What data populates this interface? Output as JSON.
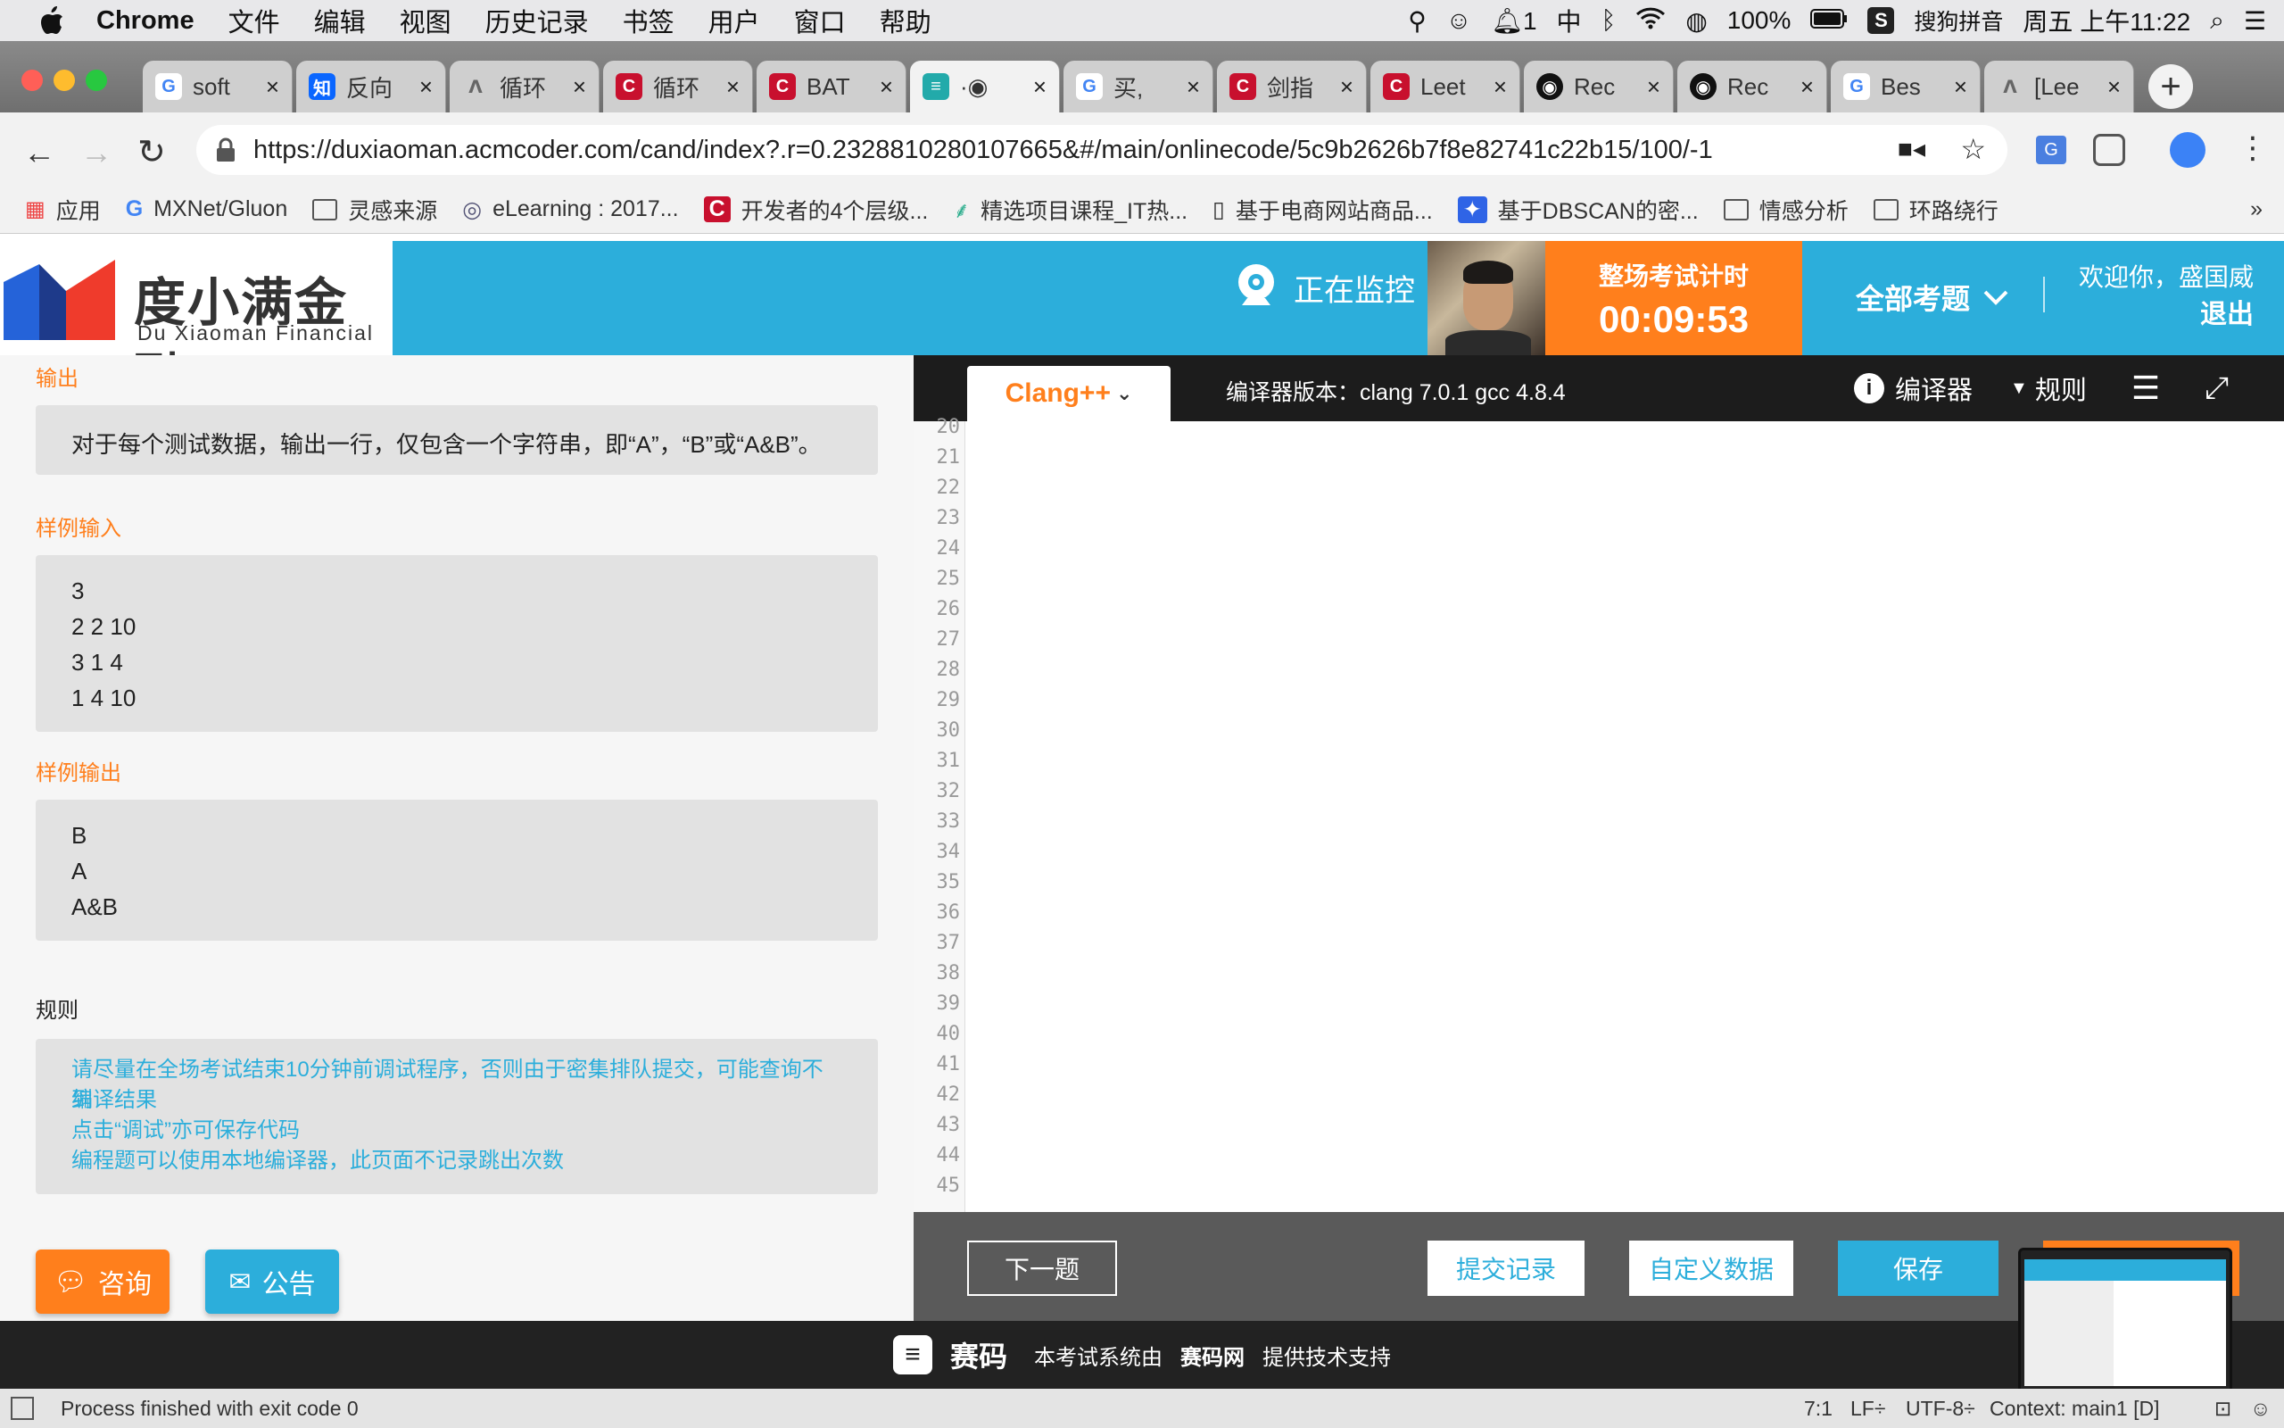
{
  "menubar": {
    "app": "Chrome",
    "items": [
      "文件",
      "编辑",
      "视图",
      "历史记录",
      "书签",
      "用户",
      "窗口",
      "帮助"
    ],
    "right": {
      "notif_count": "1",
      "ime": "中",
      "battery": "100%",
      "input_method": "搜狗拼音",
      "datetime": "周五 上午11:22"
    }
  },
  "tabs": [
    {
      "title": "soft",
      "icon": "google-icon"
    },
    {
      "title": "反向",
      "icon": "zhihu-icon"
    },
    {
      "title": "循环",
      "icon": "web-icon"
    },
    {
      "title": "循环",
      "icon": "csdn-icon"
    },
    {
      "title": "BAT",
      "icon": "csdn-icon"
    },
    {
      "title": "·◉",
      "icon": "acmcoder-icon",
      "active": true
    },
    {
      "title": "买,",
      "icon": "google-icon"
    },
    {
      "title": "剑指",
      "icon": "csdn-icon"
    },
    {
      "title": "Leet",
      "icon": "csdn-icon"
    },
    {
      "title": "Rec",
      "icon": "github-icon"
    },
    {
      "title": "Rec",
      "icon": "github-icon"
    },
    {
      "title": "Bes",
      "icon": "google-icon"
    },
    {
      "title": "[Lee",
      "icon": "web-icon"
    }
  ],
  "address": {
    "url": "https://duxiaoman.acmcoder.com/cand/index?.r=0.2328810280107665&#/main/onlinecode/5c9b2626b7f8e82741c22b15/100/-1"
  },
  "bookmarks": [
    "应用",
    "MXNet/Gluon",
    "灵感来源",
    "eLearning : 2017...",
    "开发者的4个层级...",
    "精选项目课程_IT热...",
    "基于电商网站商品...",
    "基于DBSCAN的密...",
    "情感分析",
    "环路绕行"
  ],
  "bookmarks_more": "»",
  "header": {
    "logo_cn": "度小满金融",
    "logo_en": "Du Xiaoman Financial",
    "monitor_label": "正在监控",
    "timer_label": "整场考试计时",
    "timer_value": "00:09:53",
    "all_questions": "全部考题",
    "welcome": "欢迎你，盛国威",
    "logout": "退出"
  },
  "problem": {
    "output_title": "输出",
    "output_text": "对于每个测试数据，输出一行，仅包含一个字符串，即“A”，“B”或“A&B”。",
    "sample_in_title": "样例输入",
    "sample_in": [
      "3",
      "2 2 10",
      "3 1 4",
      "1 4 10"
    ],
    "sample_out_title": "样例输出",
    "sample_out": [
      "B",
      "A",
      "A&B"
    ],
    "rules_title": "规则",
    "rules": [
      "请尽量在全场考试结束10分钟前调试程序，否则由于密集排队提交，可能查询不到",
      "编译结果",
      "点击“调试”亦可保存代码",
      "编程题可以使用本地编译器，此页面不记录跳出次数"
    ],
    "consult": "咨询",
    "notice": "公告"
  },
  "editor": {
    "language": "Clang++",
    "compiler_version": "编译器版本：clang 7.0.1 gcc 4.8.4",
    "compiler_btn": "编译器",
    "rules_btn": "规则",
    "line_numbers": [
      "20",
      "21",
      "22",
      "23",
      "24",
      "25",
      "26",
      "27",
      "28",
      "29",
      "30",
      "31",
      "32",
      "33",
      "34",
      "35",
      "36",
      "37",
      "38",
      "39",
      "40",
      "41",
      "42",
      "43",
      "44",
      "45"
    ],
    "next_btn": "下一题",
    "submit_records": "提交记录",
    "custom_data": "自定义数据",
    "save_btn": "保存"
  },
  "footer": {
    "brand": "赛码",
    "text_pre": "本考试系统由",
    "text_brand": "赛码网",
    "text_post": "提供技术支持"
  },
  "statusbar": {
    "message": "Process finished with exit code 0",
    "position": "7:1",
    "line_sep": "LF÷",
    "encoding": "UTF-8÷",
    "context": "Context: main1 [D]"
  }
}
